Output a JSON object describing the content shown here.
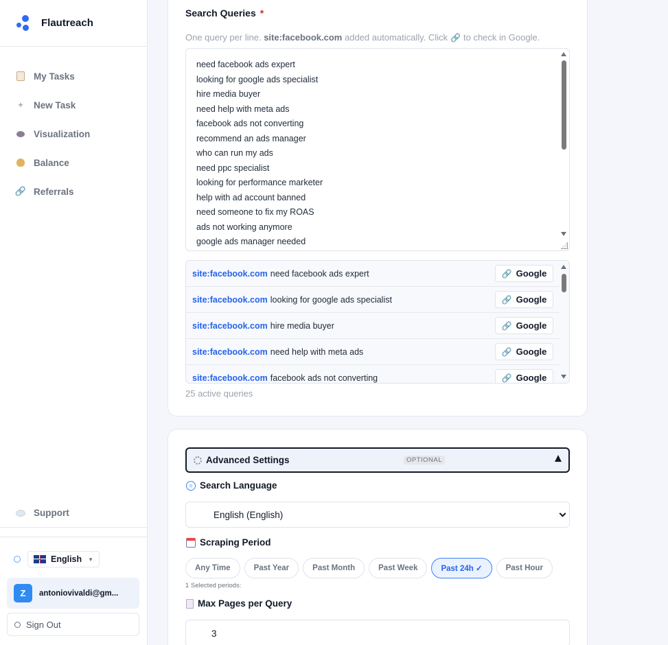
{
  "brand": {
    "name": "Flautreach"
  },
  "nav": [
    {
      "label": "My Tasks",
      "icon": "clipboard-icon"
    },
    {
      "label": "New Task",
      "icon": "plus-icon"
    },
    {
      "label": "Visualization",
      "icon": "eye-icon"
    },
    {
      "label": "Balance",
      "icon": "money-bag-icon"
    },
    {
      "label": "Referrals",
      "icon": "link-icon"
    }
  ],
  "support": {
    "label": "Support",
    "icon": "speech-bubble-icon"
  },
  "language": {
    "selected": "English",
    "flag": "uk-flag-icon"
  },
  "user": {
    "initial": "Z",
    "email": "antoniovivaldi@gm...",
    "avatar_color": "#2f8bf2"
  },
  "signout": {
    "label": "Sign Out"
  },
  "search_queries": {
    "label": "Search Queries",
    "required_mark": "*",
    "help_prefix": "One query per line.",
    "help_site": "site:facebook.com",
    "help_mid": "added automatically. Click",
    "help_suffix": "to check in Google.",
    "lines": [
      "need facebook ads expert",
      "looking for google ads specialist",
      "hire media buyer",
      "need help with meta ads",
      "facebook ads not converting",
      "recommend an ads manager",
      "who can run my ads",
      "need ppc specialist",
      "looking for performance marketer",
      "help with ad account banned",
      "need someone to fix my ROAS",
      "ads not working anymore",
      "google ads manager needed"
    ]
  },
  "preview": {
    "site": "site:facebook.com",
    "button_label": "Google",
    "rows": [
      "need facebook ads expert",
      "looking for google ads specialist",
      "hire media buyer",
      "need help with meta ads",
      "facebook ads not converting"
    ]
  },
  "active_count": "25 active queries",
  "advanced": {
    "title": "Advanced Settings",
    "badge": "OPTIONAL"
  },
  "search_language": {
    "label": "Search Language",
    "value": "English (English)"
  },
  "scraping_period": {
    "label": "Scraping Period",
    "options": [
      "Any Time",
      "Past Year",
      "Past Month",
      "Past Week",
      "Past 24h ✓",
      "Past Hour"
    ],
    "selected_index": 4,
    "note": "1 Selected periods:"
  },
  "max_pages": {
    "label": "Max Pages per Query",
    "value": "3"
  },
  "colors": {
    "accent": "#2563eb",
    "required": "#dc2626",
    "selected_chip_bg": "#eaf1ff"
  }
}
